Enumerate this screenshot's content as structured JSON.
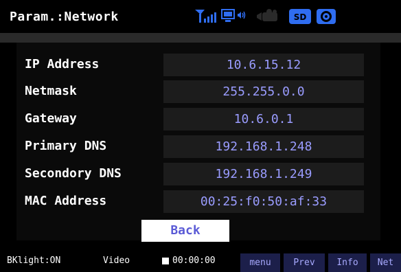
{
  "header": {
    "title": "Param.:Network",
    "icons": [
      "signal-antenna-icon",
      "monitor-audio-icon",
      "camera-icon",
      "sd-card-icon",
      "disc-icon"
    ]
  },
  "colors": {
    "value_text": "#9a9cff",
    "value_bg": "#1c1c1c",
    "icon_blue": "#2f6df0",
    "softkey_bg": "#1c1f4a"
  },
  "fields": [
    {
      "label": "IP Address",
      "value": "10.6.15.12"
    },
    {
      "label": "Netmask",
      "value": "255.255.0.0"
    },
    {
      "label": "Gateway",
      "value": "10.6.0.1"
    },
    {
      "label": "Primary DNS",
      "value": "192.168.1.248"
    },
    {
      "label": "Secondory DNS",
      "value": "192.168.1.249"
    },
    {
      "label": "MAC Address",
      "value": "00:25:f0:50:af:33"
    }
  ],
  "back_label": "Back",
  "status": {
    "backlight": "BKlight:ON",
    "mode": "Video",
    "time": "00:00:00"
  },
  "softkeys": [
    "menu",
    "Prev",
    "Info",
    "Net"
  ]
}
